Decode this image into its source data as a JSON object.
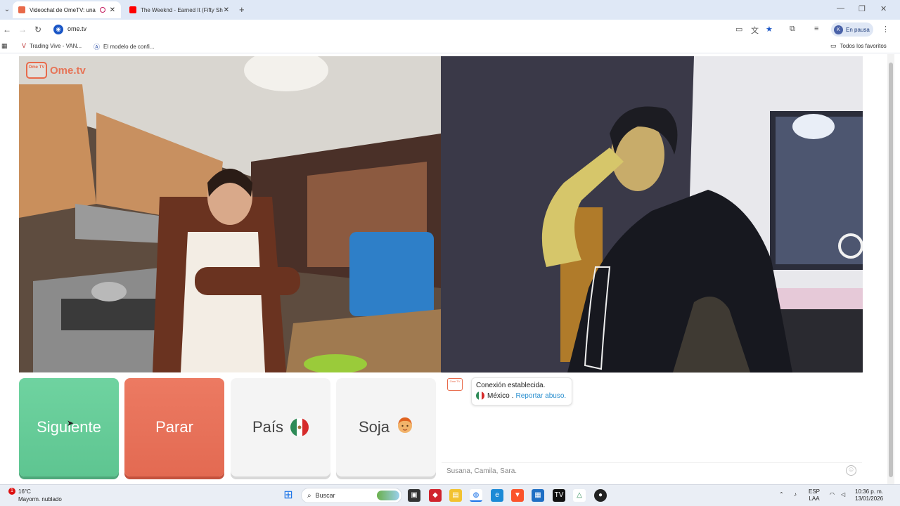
{
  "browser": {
    "tabs": [
      {
        "title": "Videochat de OmeTV: una",
        "active": true,
        "favicon_color": "#e86a4a"
      },
      {
        "title": "The Weeknd - Earned It (Fifty Sh",
        "active": false,
        "favicon_color": "#ff0000"
      }
    ],
    "new_tab_glyph": "+",
    "url": "ome.tv",
    "profile_initial": "K",
    "profile_status": "En pausa",
    "bookmarks": [
      {
        "label": "Trading Vive - VAN..."
      },
      {
        "label": "El modelo de confi..."
      }
    ],
    "all_bookmarks": "Todos los favoritos"
  },
  "site": {
    "logo_text": "Ome.tv",
    "logo_badge": "Ome TV"
  },
  "controls": {
    "next_label": "Siguiente",
    "stop_label": "Parar",
    "country_label": "País",
    "country_flag": "mexico-flag-icon",
    "gender_label": "Soja",
    "gender_icon": "boy-face-icon"
  },
  "chat": {
    "status": "Conexión establecida.",
    "country": "México",
    "separator": ".",
    "report_link": "Reportar abuso.",
    "input_placeholder": "Susana, Camila, Sara."
  },
  "taskbar": {
    "notification_count": "1",
    "temperature": "16°C",
    "weather": "Mayorm. nublado",
    "search_placeholder": "Buscar",
    "language_top": "ESP",
    "language_bottom": "LAA",
    "time": "10:36 p. m.",
    "date": "13/01/2026"
  },
  "colors": {
    "next": "#6fd3a0",
    "stop": "#e36a52",
    "brand": "#e86a4a",
    "link": "#2a8fcf"
  }
}
